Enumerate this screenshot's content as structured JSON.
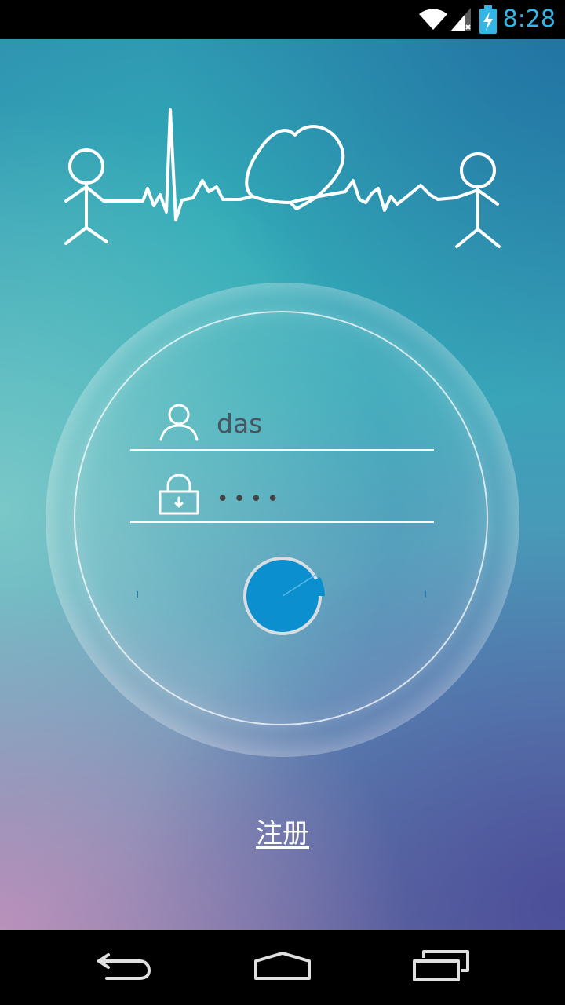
{
  "status_bar": {
    "time": "8:28",
    "icons": [
      "wifi-icon",
      "signal-icon",
      "battery-charging-icon"
    ]
  },
  "banner": {
    "icon": "heartbeat-couple-illustration"
  },
  "login": {
    "username_value": "das",
    "password_value": "••••",
    "username_icon": "user-icon",
    "password_icon": "lock-icon",
    "loading": true
  },
  "register_label": "注册",
  "nav_bar": {
    "icons": [
      "back-icon",
      "home-icon",
      "recent-apps-icon"
    ]
  },
  "colors": {
    "accent": "#33b5e5",
    "spinner_fill": "#0b8fce"
  }
}
